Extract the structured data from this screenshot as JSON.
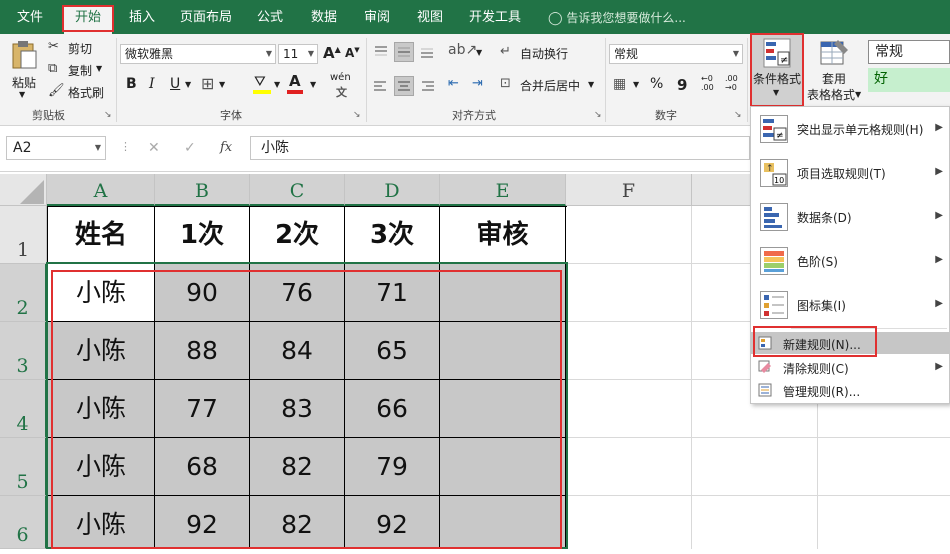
{
  "tabs": [
    {
      "label": "文件",
      "active": false
    },
    {
      "label": "开始",
      "active": true
    },
    {
      "label": "插入",
      "active": false
    },
    {
      "label": "页面布局",
      "active": false
    },
    {
      "label": "公式",
      "active": false
    },
    {
      "label": "数据",
      "active": false
    },
    {
      "label": "审阅",
      "active": false
    },
    {
      "label": "视图",
      "active": false
    },
    {
      "label": "开发工具",
      "active": false
    }
  ],
  "tell_me": "告诉我您想要做什么...",
  "ribbon": {
    "clipboard": {
      "paste": "粘贴",
      "cut": "剪切",
      "copy": "复制",
      "format_painter": "格式刷",
      "label": "剪贴板"
    },
    "font": {
      "name": "微软雅黑",
      "size": "11",
      "bold": "B",
      "italic": "I",
      "underline": "U",
      "phonetic": "wén",
      "label": "字体"
    },
    "alignment": {
      "wrap": "自动换行",
      "merge": "合并后居中",
      "label": "对齐方式"
    },
    "number": {
      "format": "常规",
      "percent": "%",
      "comma": "9",
      "label": "数字"
    },
    "styles": {
      "conditional": "条件格式",
      "table_line1": "套用",
      "table_line2": "表格格式",
      "normal": "常规",
      "good": "好"
    }
  },
  "formula_bar": {
    "name_box": "A2",
    "cancel": "✕",
    "enter": "✓",
    "fx": "fx",
    "content": "小陈"
  },
  "grid": {
    "columns": [
      "A",
      "B",
      "C",
      "D",
      "E",
      "F"
    ],
    "rows": [
      "1",
      "2",
      "3",
      "4",
      "5",
      "6"
    ],
    "header": [
      "姓名",
      "1次",
      "2次",
      "3次",
      "审核"
    ],
    "data": [
      [
        "小陈",
        "90",
        "76",
        "71",
        ""
      ],
      [
        "小陈",
        "88",
        "84",
        "65",
        ""
      ],
      [
        "小陈",
        "77",
        "83",
        "66",
        ""
      ],
      [
        "小陈",
        "68",
        "82",
        "79",
        ""
      ],
      [
        "小陈",
        "92",
        "82",
        "92",
        ""
      ]
    ]
  },
  "cf_menu": {
    "items": [
      {
        "label": "突出显示单元格规则(H)",
        "submenu": true
      },
      {
        "label": "项目选取规则(T)",
        "submenu": true
      },
      {
        "label": "数据条(D)",
        "submenu": true
      },
      {
        "label": "色阶(S)",
        "submenu": true
      },
      {
        "label": "图标集(I)",
        "submenu": true
      }
    ],
    "small_items": [
      {
        "label": "新建规则(N)...",
        "submenu": false
      },
      {
        "label": "清除规则(C)",
        "submenu": true
      },
      {
        "label": "管理规则(R)...",
        "submenu": false
      }
    ],
    "icon_labels": {
      "highlight": "≠",
      "top10": "10"
    }
  },
  "colors": {
    "excel_green": "#217346",
    "highlight_red": "#e03030",
    "shade": "#c8c8c8"
  }
}
